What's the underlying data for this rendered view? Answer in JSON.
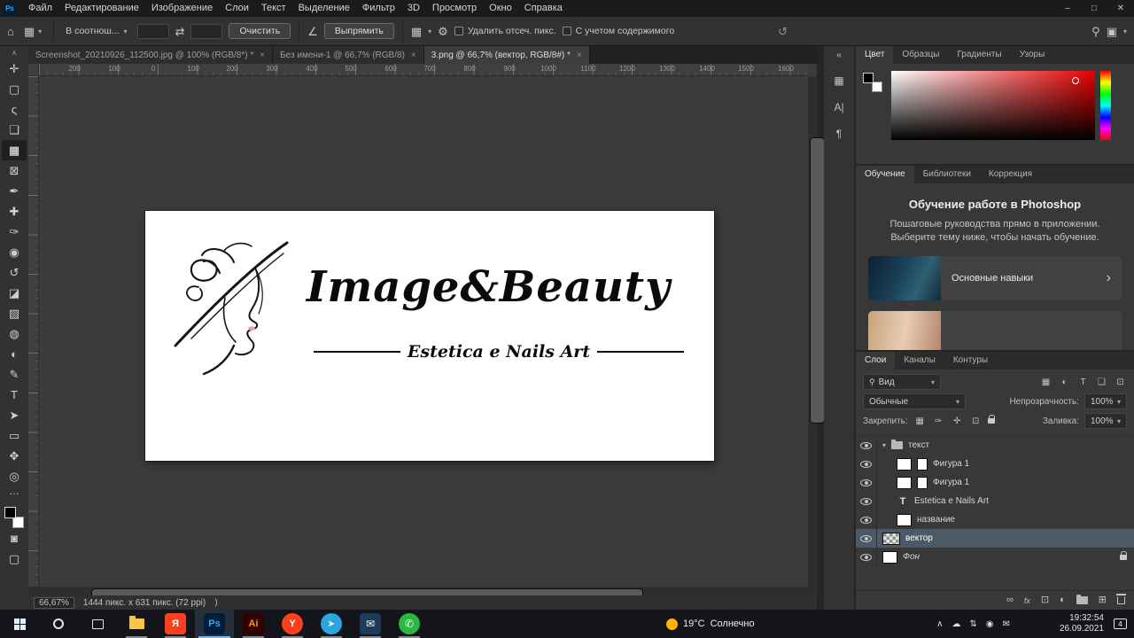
{
  "colors": {
    "accent_blue": "#31a8ff",
    "selected_layer": "#4c5a68",
    "panel_bg": "#383838",
    "taskbar_bg": "#14141b"
  },
  "titlebar": {
    "logo": "Ps",
    "menu": [
      "Файл",
      "Редактирование",
      "Изображение",
      "Слои",
      "Текст",
      "Выделение",
      "Фильтр",
      "3D",
      "Просмотр",
      "Окно",
      "Справка"
    ]
  },
  "icons": {
    "home": "⌂",
    "caret": "▾",
    "swap": "⇄",
    "angle": "∠",
    "grid": "▦",
    "gear": "⚙",
    "reset": "↺",
    "search": "⚲",
    "workspace": "▣",
    "collapse": "«",
    "char": "A|",
    "paragraph": "¶",
    "chevron_right": "›",
    "popup": "⟩",
    "tray_up": "∧",
    "link": "∞",
    "new_layer": "⊞",
    "adjustment": "◐",
    "mask": "⊡",
    "dots": "…",
    "close": "✕",
    "minimize": "–",
    "restore": "□",
    "close_tab": "×",
    "type_t": "T",
    "filter_shape": "❏",
    "lock_brush": "✑",
    "lock_move": "✛",
    "quick_mask": "◙",
    "screen_mode": "▢",
    "tg": "➤",
    "mail": "✉",
    "wa": "✆",
    "cloud": "☁",
    "updown": "⇅",
    "dot_circle": "◉"
  },
  "optionsbar": {
    "ratio": "В соотнош...",
    "clear": "Очистить",
    "straighten": "Выпрямить",
    "delete_cropped": "Удалить отсеч. пикс.",
    "content_aware": "С учетом содержимого"
  },
  "doc_tabs": [
    {
      "label": "Screenshot_20210926_112500.jpg @ 100% (RGB/8*) *"
    },
    {
      "label": "Без имени-1 @ 66,7% (RGB/8)"
    },
    {
      "label": "3.png @ 66,7% (вектор, RGB/8#) *"
    }
  ],
  "tools": [
    {
      "name": "move",
      "glyph": "✛"
    },
    {
      "name": "rectangular-marquee",
      "glyph": "▢"
    },
    {
      "name": "lasso",
      "glyph": "ς"
    },
    {
      "name": "object-selection",
      "glyph": "❏"
    },
    {
      "name": "crop",
      "glyph": "▦"
    },
    {
      "name": "frame",
      "glyph": "⊠"
    },
    {
      "name": "eyedropper",
      "glyph": "✒"
    },
    {
      "name": "spot-healing",
      "glyph": "✚"
    },
    {
      "name": "brush",
      "glyph": "✑"
    },
    {
      "name": "clone-stamp",
      "glyph": "◉"
    },
    {
      "name": "history-brush",
      "glyph": "↺"
    },
    {
      "name": "eraser",
      "glyph": "◪"
    },
    {
      "name": "gradient",
      "glyph": "▨"
    },
    {
      "name": "blur",
      "glyph": "◍"
    },
    {
      "name": "dodge",
      "glyph": "◐"
    },
    {
      "name": "pen",
      "glyph": "✎"
    },
    {
      "name": "type",
      "glyph": "T"
    },
    {
      "name": "path-selection",
      "glyph": "➤"
    },
    {
      "name": "rectangle",
      "glyph": "▭"
    },
    {
      "name": "hand",
      "glyph": "✥"
    },
    {
      "name": "zoom",
      "glyph": "◎"
    }
  ],
  "ruler": [
    "200",
    "100",
    "0",
    "100",
    "200",
    "300",
    "400",
    "500",
    "600",
    "700",
    "800",
    "900",
    "1000",
    "1100",
    "1200",
    "1300",
    "1400",
    "1500",
    "1600"
  ],
  "artboard": {
    "title": "Image&Beauty",
    "subtitle": "Estetica e Nails Art"
  },
  "statusbar": {
    "zoom": "66,67%",
    "info": "1444 пикс. x 631 пикс. (72 ppi)"
  },
  "panels": {
    "color": {
      "tabs": [
        "Цвет",
        "Образцы",
        "Градиенты",
        "Узоры"
      ]
    },
    "learn": {
      "tabs": [
        "Обучение",
        "Библиотеки",
        "Коррекция"
      ],
      "heading": "Обучение работе в Photoshop",
      "body": "Пошаговые руководства прямо в приложении. Выберите тему ниже, чтобы начать обучение.",
      "card": "Основные навыки"
    },
    "layers": {
      "tabs": [
        "Слои",
        "Каналы",
        "Контуры"
      ],
      "filter": "Вид",
      "blend": "Обычные",
      "opacity_label": "Непрозрачность:",
      "opacity": "100%",
      "lock_label": "Закрепить:",
      "fill_label": "Заливка:",
      "fill": "100%",
      "fx": "fx",
      "rows": [
        {
          "name": "текст"
        },
        {
          "name": "Фигура 1"
        },
        {
          "name": "Фигура 1"
        },
        {
          "name": "Estetica e Nails Art"
        },
        {
          "name": "название"
        },
        {
          "name": "вектор"
        },
        {
          "name": "Фон"
        }
      ]
    }
  },
  "taskbar": {
    "ya": "Я",
    "ps": "Ps",
    "ai": "Ai",
    "browser": "Y",
    "weather_temp": "19°C",
    "weather_cond": "Солнечно",
    "time": "19:32:54",
    "date": "26.09.2021",
    "badge": "4"
  }
}
